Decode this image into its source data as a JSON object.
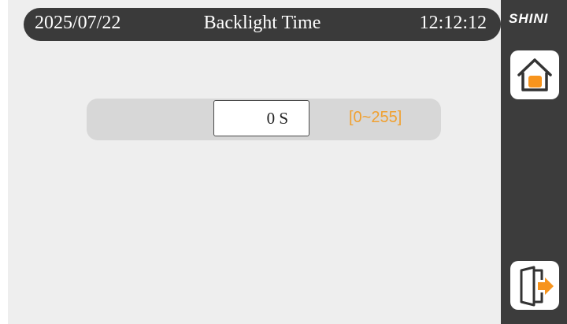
{
  "header": {
    "date": "2025/07/22",
    "title": "Backlight Time",
    "time": "12:12:12"
  },
  "setting": {
    "value": "0 S",
    "range": "[0~255]"
  },
  "side_panel": {
    "brand": "SHINI",
    "buttons": [
      {
        "icon": "home-icon"
      },
      {
        "icon": "exit-door-icon"
      }
    ]
  },
  "colors": {
    "header_bg": "#3a3a3a",
    "screen_bg": "#eeeeee",
    "row_bg": "#d7d7d7",
    "range_text": "#f0a030",
    "side_panel_bg": "#3c3c3c",
    "accent": "#f7941d"
  }
}
